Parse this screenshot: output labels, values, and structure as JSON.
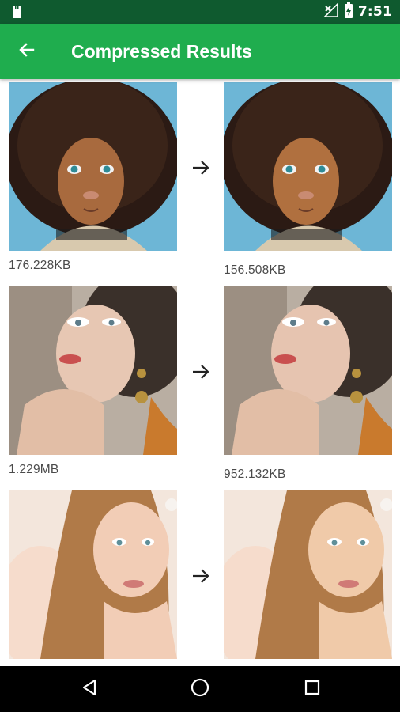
{
  "status_bar": {
    "time": "7:51"
  },
  "app_bar": {
    "title": "Compressed Results"
  },
  "results": [
    {
      "original_size": "176.228KB",
      "compressed_size": "156.508KB"
    },
    {
      "original_size": "1.229MB",
      "compressed_size": "952.132KB"
    },
    {
      "original_size": "",
      "compressed_size": ""
    }
  ],
  "colors": {
    "status_bar": "#0f5a2f",
    "app_bar": "#1fad4e",
    "nav_bar": "#000000"
  },
  "icons": {
    "back": "arrow-left-icon",
    "row_arrow": "arrow-right-icon",
    "nav_back": "triangle-back-icon",
    "nav_home": "circle-home-icon",
    "nav_recents": "square-recents-icon"
  }
}
